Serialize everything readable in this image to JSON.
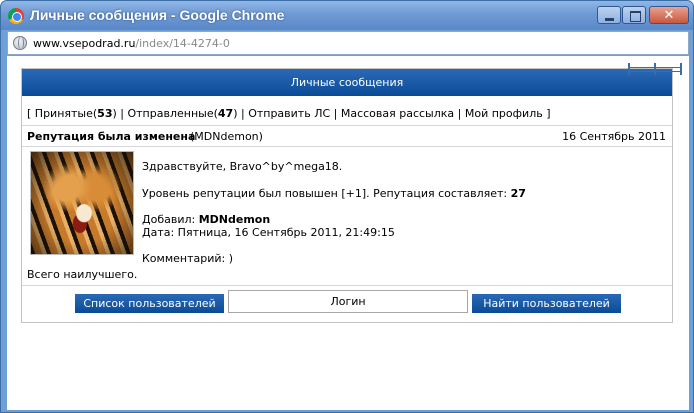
{
  "window": {
    "title": "Личные сообщения - Google Chrome",
    "close_glyph": "✕"
  },
  "address": {
    "host": "www.vsepodrad.ru",
    "path": "/index/14-4274-0"
  },
  "panel": {
    "header": "Личные сообщения",
    "nav": {
      "open_bracket": "[ ",
      "received_label": "Принятые(",
      "received_count": "53",
      "received_close": ")",
      "sep1": " | ",
      "sent_label": "Отправленные(",
      "sent_count": "47",
      "sent_close": ")",
      "sep2": " | ",
      "send_pm": "Отправить ЛС",
      "sep3": " | ",
      "mass_mail": "Массовая рассылка",
      "sep4": " | ",
      "my_profile": "Мой профиль",
      "close_bracket": " ]"
    },
    "message": {
      "subject": "Репутация была изменена",
      "author": "(MDNdemon)",
      "date": "16 Сентябрь 2011",
      "greeting": "Здравствуйте, Bravo^by^mega18.",
      "reputation_text": "Уровень репутации был повышен [+1]. Репутация составляет: ",
      "reputation_value": "27",
      "added_by_label": "Добавил: ",
      "added_by_value": "MDNdemon",
      "date_line": "Дата: Пятница, 16 Сентябрь 2011, 21:49:15",
      "comment": "Комментарий: )",
      "closing": "Всего наилучшего."
    },
    "footer": {
      "users_list_button": "Список пользователей",
      "login_field": "Логин",
      "find_user_button": "Найти пользователей"
    }
  },
  "colors": {
    "title_bar": "#6f9ad3",
    "header_blue": "#0a4b98"
  }
}
